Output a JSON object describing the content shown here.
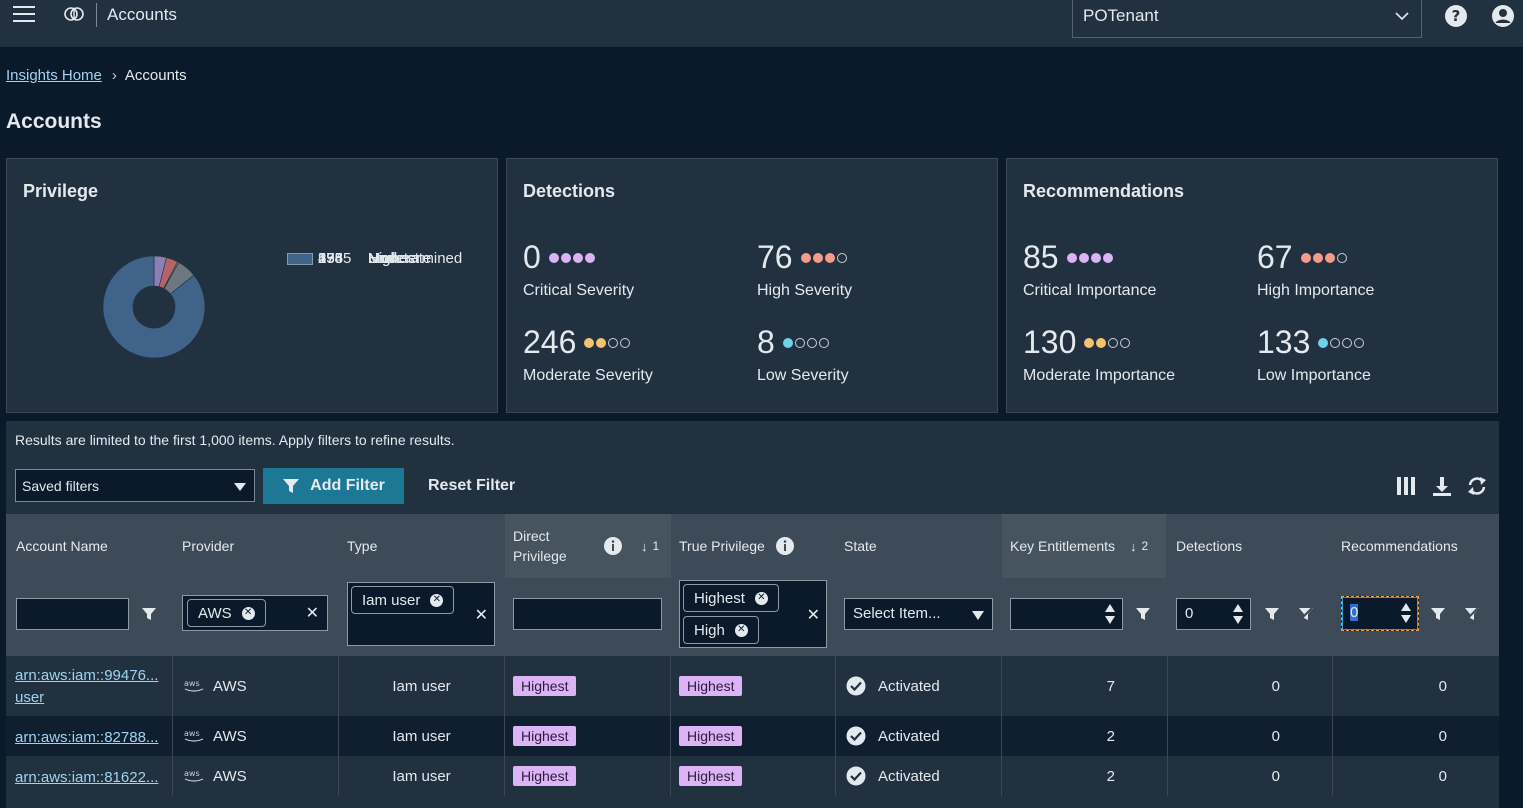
{
  "header": {
    "title": "Accounts",
    "tenant": "POTenant"
  },
  "breadcrumb": {
    "home": "Insights Home",
    "current": "Accounts"
  },
  "page_title": "Accounts",
  "privilege": {
    "title": "Privilege",
    "items": [
      {
        "count": "274",
        "label": "Highest",
        "color": "#8b7fb8"
      },
      {
        "count": "258",
        "label": "High",
        "color": "#b26566"
      },
      {
        "count": "27",
        "label": "Moderate",
        "color": "#9c8a66"
      },
      {
        "count": "1",
        "label": "Low",
        "color": "#4b8ea3"
      },
      {
        "count": "435",
        "label": "None",
        "color": "#6c7780"
      },
      {
        "count": "5965",
        "label": "Undetermined",
        "color": "#3f6389"
      }
    ]
  },
  "detections": {
    "title": "Detections",
    "metrics": [
      {
        "value": "0",
        "label": "Critical Severity",
        "level": 4,
        "color": "#dcb4f5"
      },
      {
        "value": "76",
        "label": "High Severity",
        "level": 3,
        "color": "#f59b8d"
      },
      {
        "value": "246",
        "label": "Moderate Severity",
        "level": 2,
        "color": "#f3c36d"
      },
      {
        "value": "8",
        "label": "Low Severity",
        "level": 1,
        "color": "#6fd0ea"
      }
    ]
  },
  "recommendations": {
    "title": "Recommendations",
    "metrics": [
      {
        "value": "85",
        "label": "Critical Importance",
        "level": 4,
        "color": "#dcb4f5"
      },
      {
        "value": "67",
        "label": "High Importance",
        "level": 3,
        "color": "#f59b8d"
      },
      {
        "value": "130",
        "label": "Moderate Importance",
        "level": 2,
        "color": "#f3c36d"
      },
      {
        "value": "133",
        "label": "Low Importance",
        "level": 1,
        "color": "#6fd0ea"
      }
    ]
  },
  "results": {
    "notice": "Results are limited to the first 1,000 items. Apply filters to refine results.",
    "saved_filters": "Saved filters",
    "add_filter": "Add Filter",
    "reset_filter": "Reset Filter"
  },
  "table": {
    "columns": {
      "account_name": "Account Name",
      "provider": "Provider",
      "type": "Type",
      "direct_privilege": "Direct Privilege",
      "direct_sort": "1",
      "true_privilege": "True Privilege",
      "state": "State",
      "key_entitlements": "Key Entitlements",
      "key_sort": "2",
      "detections": "Detections",
      "recommendations": "Recommendations"
    },
    "filters": {
      "provider_chip": "AWS",
      "type_chip": "Iam user",
      "true_chip_1": "Highest",
      "true_chip_2": "High",
      "state_select": "Select Item...",
      "detections_value": "0",
      "recommendations_value": "0"
    },
    "rows": [
      {
        "name": "arn:aws:iam::99476...",
        "name2": "user",
        "provider": "AWS",
        "type": "Iam user",
        "direct": "Highest",
        "true": "Highest",
        "state": "Activated",
        "key": "7",
        "detections": "0",
        "recommendations": "0"
      },
      {
        "name": "arn:aws:iam::82788...",
        "name2": "",
        "provider": "AWS",
        "type": "Iam user",
        "direct": "Highest",
        "true": "Highest",
        "state": "Activated",
        "key": "2",
        "detections": "0",
        "recommendations": "0"
      },
      {
        "name": "arn:aws:iam::81622...",
        "name2": "",
        "provider": "AWS",
        "type": "Iam user",
        "direct": "Highest",
        "true": "Highest",
        "state": "Activated",
        "key": "2",
        "detections": "0",
        "recommendations": "0"
      }
    ]
  }
}
